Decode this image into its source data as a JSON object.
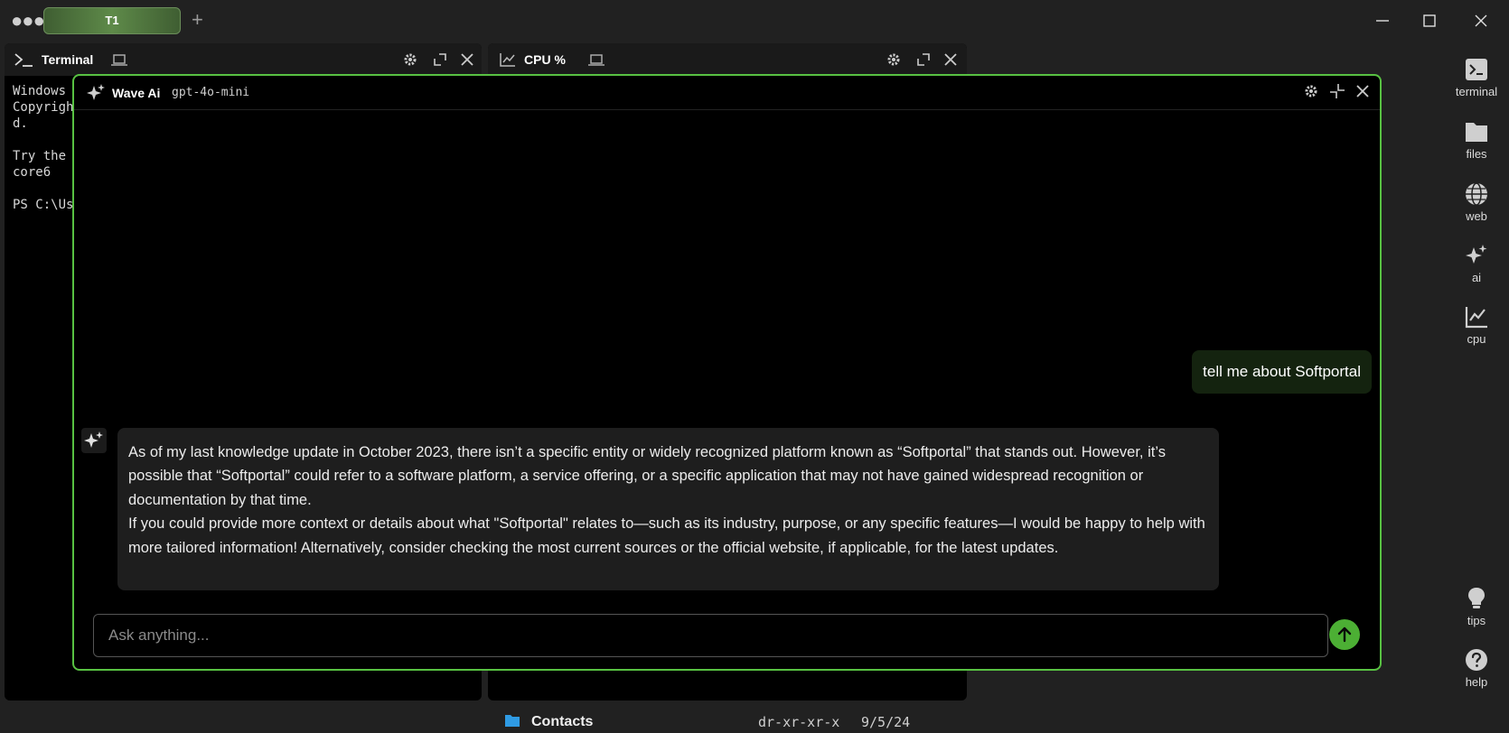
{
  "window": {
    "tabs": [
      {
        "label": "T1"
      }
    ],
    "add_tab": "+"
  },
  "panes": {
    "terminal": {
      "title": "Terminal",
      "icon": "terminal-prompt-icon",
      "lines": [
        "Windows",
        "Copyrigh",
        "d.",
        "",
        "Try the",
        "core6",
        "",
        "PS C:\\Us"
      ]
    },
    "cpu": {
      "title": "CPU %",
      "icon": "chart-line-icon",
      "contacts": {
        "name": "Contacts",
        "perms": "dr-xr-xr-x",
        "date": "9/5/24"
      }
    }
  },
  "ai": {
    "title": "Wave Ai",
    "model": "gpt-4o-mini",
    "user_message": "tell me about Softportal",
    "assistant_paragraphs": [
      "As of my last knowledge update in October 2023, there isn’t a specific entity or widely recognized platform known as “Softportal” that stands out. However, it’s possible that “Softportal” could refer to a software platform, a service offering, or a specific application that may not have gained widespread recognition or documentation by that time.",
      "If you could provide more context or details about what \"Softportal\" relates to—such as its industry, purpose, or any specific features—I would be happy to help with more tailored information! Alternatively, consider checking the most current sources or the official website, if applicable, for the latest updates."
    ],
    "input_placeholder": "Ask anything...",
    "input_value": "",
    "accent": "#58c142"
  },
  "sidebar": {
    "items": [
      {
        "label": "terminal",
        "icon": "terminal-icon"
      },
      {
        "label": "files",
        "icon": "folder-icon"
      },
      {
        "label": "web",
        "icon": "globe-icon"
      },
      {
        "label": "ai",
        "icon": "sparkles-icon"
      },
      {
        "label": "cpu",
        "icon": "chart-line-icon"
      }
    ],
    "bottom": [
      {
        "label": "tips",
        "icon": "lightbulb-icon"
      },
      {
        "label": "help",
        "icon": "help-circle-icon"
      }
    ]
  }
}
